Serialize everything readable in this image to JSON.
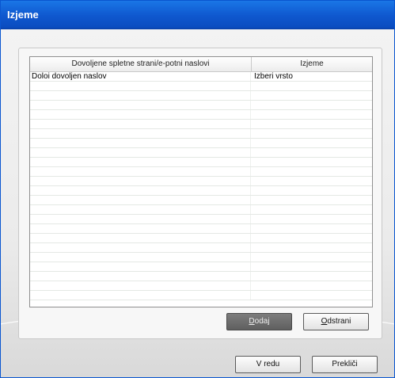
{
  "window": {
    "title": "Izjeme"
  },
  "table": {
    "columns": [
      "Dovoljene spletne strani/e-potni naslovi",
      "Izjeme"
    ],
    "rows": [
      [
        "Doloi dovoljen naslov",
        "Izberi vrsto"
      ],
      [
        "",
        ""
      ],
      [
        "",
        ""
      ],
      [
        "",
        ""
      ],
      [
        "",
        ""
      ],
      [
        "",
        ""
      ],
      [
        "",
        ""
      ],
      [
        "",
        ""
      ],
      [
        "",
        ""
      ],
      [
        "",
        ""
      ],
      [
        "",
        ""
      ],
      [
        "",
        ""
      ],
      [
        "",
        ""
      ],
      [
        "",
        ""
      ],
      [
        "",
        ""
      ],
      [
        "",
        ""
      ],
      [
        "",
        ""
      ],
      [
        "",
        ""
      ],
      [
        "",
        ""
      ],
      [
        "",
        ""
      ],
      [
        "",
        ""
      ],
      [
        "",
        ""
      ],
      [
        "",
        ""
      ],
      [
        "",
        ""
      ]
    ]
  },
  "buttons": {
    "add_mnemonic": "D",
    "add_rest": "odaj",
    "remove_mnemonic": "O",
    "remove_rest": "dstrani",
    "ok": "V redu",
    "cancel": "Prekliči"
  },
  "colors": {
    "titlebar": "#0f58cf",
    "disabled_button": "#6e6e6e"
  }
}
